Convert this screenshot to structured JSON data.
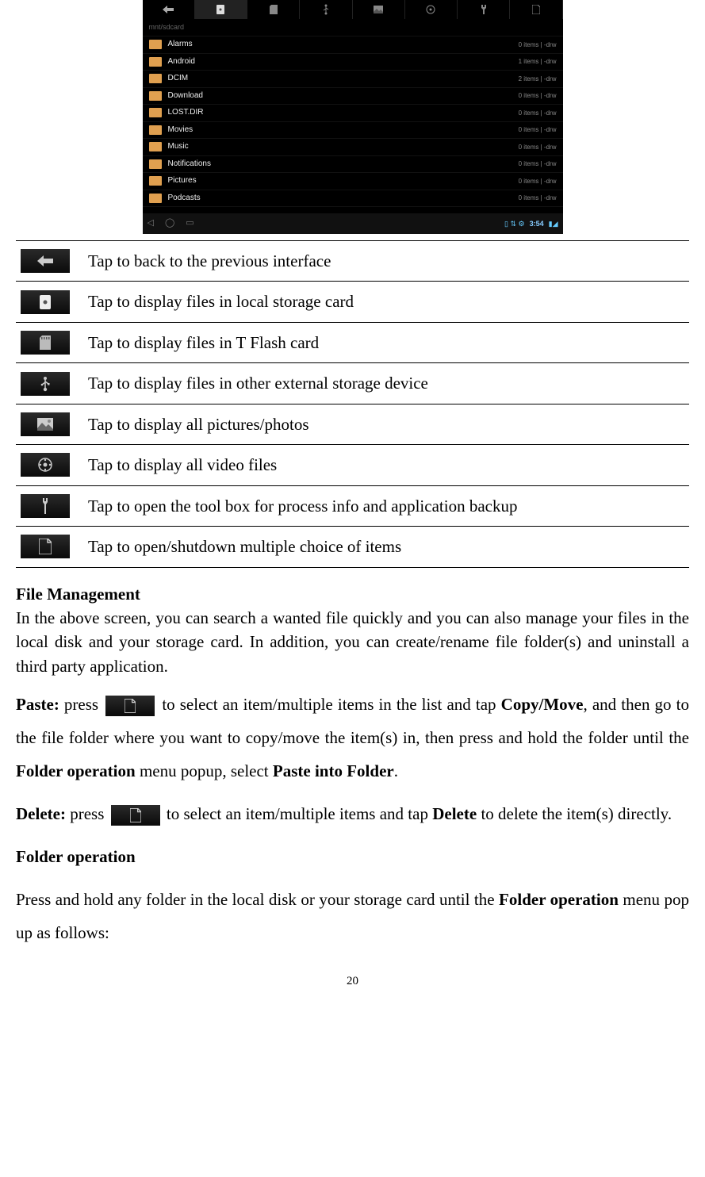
{
  "screenshot": {
    "breadcrumb": "mnt/sdcard",
    "folders": [
      {
        "name": "Alarms",
        "meta": "0 items | -drw"
      },
      {
        "name": "Android",
        "meta": "1 items | -drw"
      },
      {
        "name": "DCIM",
        "meta": "2 items | -drw"
      },
      {
        "name": "Download",
        "meta": "0 items | -drw"
      },
      {
        "name": "LOST.DIR",
        "meta": "0 items | -drw"
      },
      {
        "name": "Movies",
        "meta": "0 items | -drw"
      },
      {
        "name": "Music",
        "meta": "0 items | -drw"
      },
      {
        "name": "Notifications",
        "meta": "0 items | -drw"
      },
      {
        "name": "Pictures",
        "meta": "0 items | -drw"
      },
      {
        "name": "Podcasts",
        "meta": "0 items | -drw"
      }
    ],
    "time": "3:54"
  },
  "icon_rows": [
    {
      "key": "back",
      "desc": "Tap to back to the previous interface"
    },
    {
      "key": "local",
      "desc": "Tap to display files in local storage card"
    },
    {
      "key": "tflash",
      "desc": "Tap to display files in T Flash card"
    },
    {
      "key": "usb",
      "desc": "Tap to display files in other external storage device"
    },
    {
      "key": "photos",
      "desc": "Tap to display all pictures/photos"
    },
    {
      "key": "videos",
      "desc": "Tap to display all video files"
    },
    {
      "key": "toolbox",
      "desc": "Tap to open the tool box for process info and application backup"
    },
    {
      "key": "multiselect",
      "desc": "Tap to open/shutdown multiple choice of items"
    }
  ],
  "section": {
    "bullet_title": "File Management",
    "intro": "In the above screen, you can search a wanted file quickly and you can also manage your files in the local disk and your storage card. In addition, you can create/rename file folder(s) and uninstall a third party application.",
    "paste_bold": "Paste:",
    "paste_a": " press ",
    "paste_b": " to select an item/multiple items in the list and tap ",
    "copy_move": "Copy/Move",
    "paste_c": ", and then go to the file folder where you want to copy/move the item(s) in, then press and hold the folder until the ",
    "folder_op1": "Folder operation",
    "paste_d": " menu popup, select ",
    "paste_into": "Paste into Folder",
    "paste_e": ".",
    "delete_bold": "Delete:",
    "delete_a": " press ",
    "delete_b": " to select an item/multiple items and tap ",
    "delete_word": "Delete",
    "delete_c": " to delete the item(s) directly.",
    "folder_op_heading": "Folder operation",
    "folder_op_text_a": "Press and hold any folder in the local disk or your storage card until the ",
    "folder_op_bold": "Folder operation",
    "folder_op_text_b": " menu pop up as follows:"
  },
  "page_number": "20"
}
